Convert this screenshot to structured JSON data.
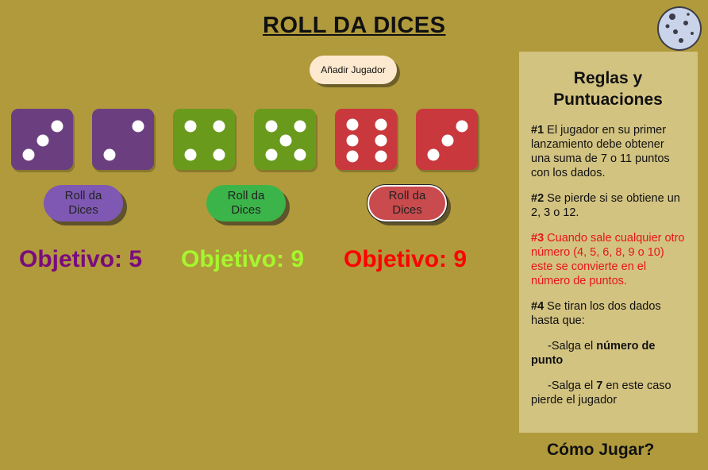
{
  "header": {
    "title": "ROLL DA DICES",
    "add_player_label": "Añadir Jugador"
  },
  "players": [
    {
      "color": "#6b3f7f",
      "dice": [
        3,
        2
      ],
      "roll_label": "Roll da Dices",
      "button_color": "#7f58b3",
      "objective_label": "Objetivo: 5",
      "objective_color": "#7a0b7d"
    },
    {
      "color": "#6a9a1c",
      "dice": [
        4,
        5
      ],
      "roll_label": "Roll da Dices",
      "button_color": "#3bb54a",
      "objective_label": "Objetivo: 9",
      "objective_color": "#a6f62e"
    },
    {
      "color": "#c9383d",
      "dice": [
        6,
        3
      ],
      "roll_label": "Roll da Dices",
      "button_color": "#c94b4e",
      "objective_label": "Objetivo: 9",
      "objective_color": "#ff0000"
    }
  ],
  "rules": {
    "title": "Reglas y Puntuaciones",
    "rule1_num": "#1",
    "rule1_text": " El jugador en su primer lanzamiento debe obtener una suma de 7 o 11 puntos con los dados.",
    "rule2_num": "#2",
    "rule2_text": " Se pierde si se obtiene un 2, 3 o 12.",
    "rule3_num": "#3",
    "rule3_text": " Cuando sale cualquier otro número (4, 5, 6, 8, 9 o 10) este se convierte en el número de puntos.",
    "rule4_num": "#4",
    "rule4_text": " Se tiran los dos dados hasta que:",
    "sub1_pre": "-Salga el ",
    "sub1_bold": "número de punto",
    "sub2_pre": "-Salga el ",
    "sub2_bold": "7",
    "sub2_post": " en este caso pierde el jugador"
  },
  "footer": {
    "howto_label": "Cómo Jugar?"
  },
  "icons": {
    "moon": "moon-icon"
  }
}
